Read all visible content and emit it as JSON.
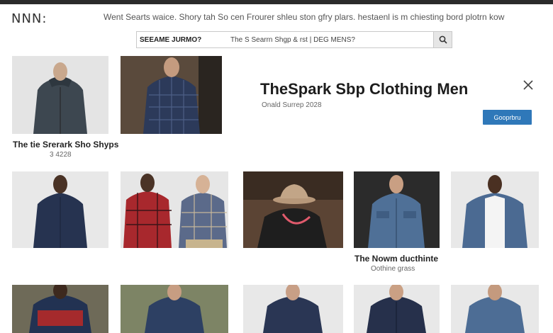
{
  "header": {
    "logo": "NNN:",
    "tagline": "Went Searts waice. Shory tah So cen Frourer shleu ston gfry plars. hestaenl is m chiesting bord plotrn kow"
  },
  "search": {
    "prefix": "SEEAME JURMO?",
    "query": "The S Searrn Shgp & rst | DEG MENS?",
    "icon": "search-icon"
  },
  "product_top_left": {
    "title": "The tie Srerark Sho Shyps",
    "subtitle": "3 4228"
  },
  "feature": {
    "title": "TheSpark Sbp Clothing Men",
    "subtitle": "Onald Surrep 2028",
    "cta_label": "Gooprbru",
    "close_icon": "close-icon"
  },
  "product_mid_right": {
    "title": "The Nowm ducthinte",
    "subtitle": "Oothine grass"
  },
  "colors": {
    "cta": "#2f78b9",
    "topbar": "#2b2b2b"
  }
}
